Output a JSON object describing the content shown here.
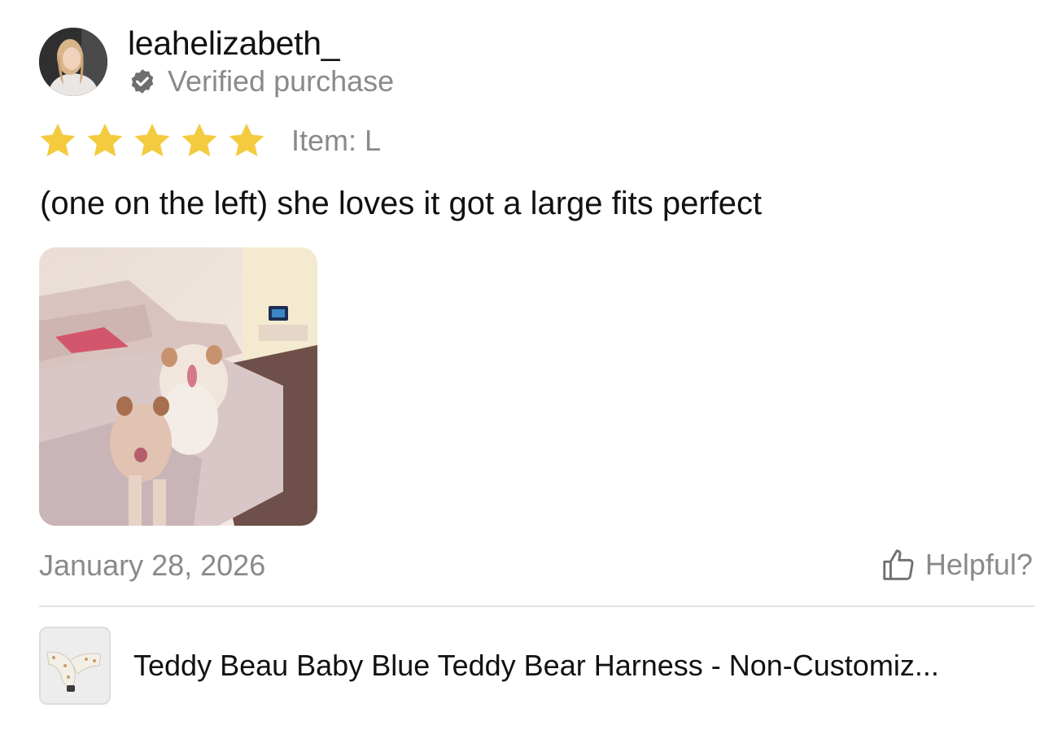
{
  "reviewer": {
    "username": "leahelizabeth_",
    "verified_label": "Verified purchase"
  },
  "rating": {
    "stars": 5,
    "max": 5,
    "item_label": "Item: L",
    "star_color": "#F4CB3F"
  },
  "review": {
    "text": "(one on the left) she loves it got a large fits perfect",
    "date": "January 28, 2026",
    "helpful_label": "Helpful?"
  },
  "product": {
    "title": "Teddy Beau Baby Blue Teddy Bear Harness - Non-Customiz..."
  },
  "colors": {
    "muted_text": "#8a8a8a",
    "divider": "#e3e3e3"
  }
}
